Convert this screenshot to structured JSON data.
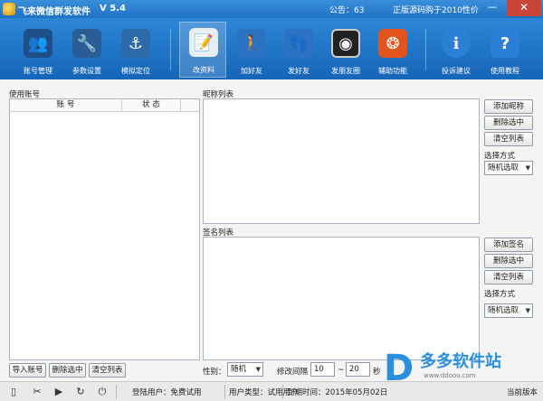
{
  "window": {
    "title": "飞来微信群发软件",
    "version": "V 5.4",
    "notice": "公告：63",
    "pay_hint": "正版源码购于2010性价",
    "minimize_glyph": "—",
    "close_glyph": "✕"
  },
  "toolbar": {
    "items": [
      {
        "label": "账号管理",
        "icon": "users-icon",
        "glyph": "👥",
        "color": "#1f4f8a"
      },
      {
        "label": "参数设置",
        "icon": "tools-icon",
        "glyph": "🔧",
        "color": "#2a5d95"
      },
      {
        "label": "模拟定位",
        "icon": "anchor-icon",
        "glyph": "⚓",
        "color": "#2c6aa8"
      },
      {
        "label": "改资料",
        "icon": "notepad-icon",
        "glyph": "📝",
        "color": "#e8eef4"
      },
      {
        "label": "加好友",
        "icon": "person-icon",
        "glyph": "🚶",
        "color": "#2b73c2"
      },
      {
        "label": "发好友",
        "icon": "footprints-icon",
        "glyph": "👣",
        "color": "#2b73c2"
      },
      {
        "label": "发朋友圈",
        "icon": "camera-icon",
        "glyph": "◉",
        "color": "#222222"
      },
      {
        "label": "辅助功能",
        "icon": "ubuntu-icon",
        "glyph": "❂",
        "color": "#e2541d"
      },
      {
        "label": "投诉建议",
        "icon": "info-icon",
        "glyph": "i",
        "color": "#2b7fd4"
      },
      {
        "label": "使用教程",
        "icon": "help-icon",
        "glyph": "?",
        "color": "#2b7fd4"
      }
    ]
  },
  "accounts": {
    "section_label": "使用账号",
    "columns": [
      "账 号",
      "状 态"
    ],
    "import_button": "导入账号",
    "delete_button": "删除选中",
    "clear_button": "清空列表"
  },
  "nicknames": {
    "section_label": "昵称列表",
    "add_button": "添加昵称",
    "delete_button": "删除选中",
    "clear_button": "清空列表",
    "mode_label": "选择方式",
    "mode_value": "随机选取"
  },
  "signatures": {
    "section_label": "签名列表",
    "add_button": "添加签名",
    "delete_button": "删除选中",
    "clear_button": "清空列表",
    "mode_label": "选择方式",
    "mode_value": "随机选取"
  },
  "options": {
    "gender_label": "性别：",
    "gender_value": "随机",
    "interval_label": "修改间隔",
    "interval_min": "10",
    "interval_sep": "~",
    "interval_max": "20",
    "interval_unit": "秒"
  },
  "status": {
    "login_user": "登陆用户：免费试用",
    "user_type": "用户类型：试用用户",
    "expiry": "到期时间：2015年05月02日",
    "right_text": "当前版本"
  },
  "watermark": {
    "logo": "D",
    "name": "多多软件站",
    "url": "www.ddooo.com"
  }
}
